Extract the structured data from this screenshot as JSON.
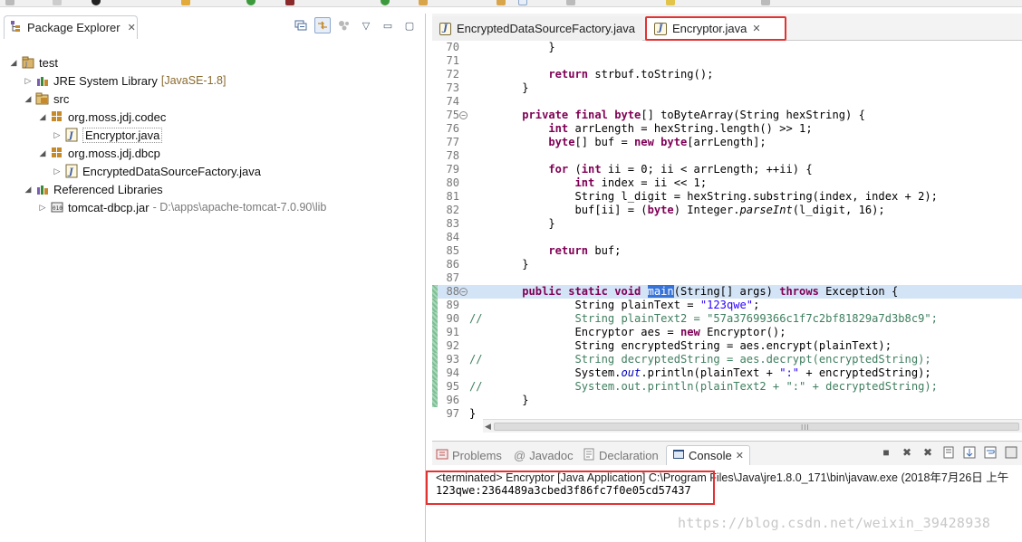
{
  "package_explorer": {
    "tab_label": "Package Explorer",
    "tree": [
      {
        "label": "test",
        "indent": 0,
        "twisty": "▲",
        "icon": "project-icon"
      },
      {
        "label": "JRE System Library",
        "decor": "[JavaSE-1.8]",
        "indent": 1,
        "twisty": "▷",
        "icon": "library-icon"
      },
      {
        "label": "src",
        "indent": 1,
        "twisty": "▲",
        "icon": "source-folder-icon"
      },
      {
        "label": "org.moss.jdj.codec",
        "indent": 2,
        "twisty": "▲",
        "icon": "package-icon"
      },
      {
        "label": "Encryptor.java",
        "indent": 3,
        "twisty": "▷",
        "icon": "java-file-icon",
        "selected": true
      },
      {
        "label": "org.moss.jdj.dbcp",
        "indent": 2,
        "twisty": "▲",
        "icon": "package-icon"
      },
      {
        "label": "EncryptedDataSourceFactory.java",
        "indent": 3,
        "twisty": "▷",
        "icon": "java-file-icon"
      },
      {
        "label": "Referenced Libraries",
        "indent": 1,
        "twisty": "▲",
        "icon": "library-icon"
      },
      {
        "label": "tomcat-dbcp.jar",
        "path": "- D:\\apps\\apache-tomcat-7.0.90\\lib",
        "indent": 2,
        "twisty": "▷",
        "icon": "jar-icon"
      }
    ]
  },
  "editor": {
    "tabs": [
      {
        "label": "EncryptedDataSourceFactory.java",
        "active": false
      },
      {
        "label": "Encryptor.java",
        "active": true
      }
    ],
    "lines": [
      {
        "n": "70",
        "code": "            }"
      },
      {
        "n": "71",
        "code": ""
      },
      {
        "n": "72",
        "code": "            return strbuf.toString();"
      },
      {
        "n": "73",
        "code": "        }"
      },
      {
        "n": "74",
        "code": ""
      },
      {
        "n": "75",
        "code": "        private final byte[] toByteArray(String hexString) {",
        "fold": true
      },
      {
        "n": "76",
        "code": "            int arrLength = hexString.length() >> 1;"
      },
      {
        "n": "77",
        "code": "            byte[] buf = new byte[arrLength];"
      },
      {
        "n": "78",
        "code": ""
      },
      {
        "n": "79",
        "code": "            for (int ii = 0; ii < arrLength; ++ii) {"
      },
      {
        "n": "80",
        "code": "                int index = ii << 1;"
      },
      {
        "n": "81",
        "code": "                String l_digit = hexString.substring(index, index + 2);"
      },
      {
        "n": "82",
        "code": "                buf[ii] = (byte) Integer.parseInt(l_digit, 16);"
      },
      {
        "n": "83",
        "code": "            }"
      },
      {
        "n": "84",
        "code": ""
      },
      {
        "n": "85",
        "code": "            return buf;"
      },
      {
        "n": "86",
        "code": "        }"
      },
      {
        "n": "87",
        "code": ""
      },
      {
        "n": "88",
        "code": "        public static void main(String[] args) throws Exception {",
        "fold": true,
        "current": true,
        "changed": true
      },
      {
        "n": "89",
        "code": "                String plainText = \"123qwe\";",
        "changed": true
      },
      {
        "n": "90",
        "code": "//              String plainText2 = \"57a37699366c1f7c2bf81829a7d3b8c9\";",
        "changed": true
      },
      {
        "n": "91",
        "code": "                Encryptor aes = new Encryptor();",
        "changed": true
      },
      {
        "n": "92",
        "code": "                String encryptedString = aes.encrypt(plainText);",
        "changed": true
      },
      {
        "n": "93",
        "code": "//              String decryptedString = aes.decrypt(encryptedString);",
        "changed": true
      },
      {
        "n": "94",
        "code": "                System.out.println(plainText + \":\" + encryptedString);",
        "changed": true
      },
      {
        "n": "95",
        "code": "//              System.out.println(plainText2 + \":\" + decryptedString);",
        "changed": true
      },
      {
        "n": "96",
        "code": "        }",
        "changed": true
      },
      {
        "n": "97",
        "code": "}"
      }
    ]
  },
  "console": {
    "tabs": [
      {
        "label": "Problems",
        "icon": "problems-icon",
        "active": false
      },
      {
        "label": "Javadoc",
        "icon": "javadoc-icon",
        "active": false
      },
      {
        "label": "Declaration",
        "icon": "declaration-icon",
        "active": false
      },
      {
        "label": "Console",
        "icon": "console-icon",
        "active": true
      }
    ],
    "terminated_line": "<terminated> Encryptor [Java Application] C:\\Program Files\\Java\\jre1.8.0_171\\bin\\javaw.exe (2018年7月26日 上午",
    "output": "123qwe:2364489a3cbed3f86fc7f0e05cd57437"
  },
  "watermark": "https://blog.csdn.net/weixin_39428938",
  "colors": {
    "keyword": "#7f0055",
    "string": "#2a00ff",
    "comment": "#3f7f5f",
    "highlight_box": "#e23232",
    "current_line": "#d4e4f7",
    "selection": "#3874d8"
  }
}
